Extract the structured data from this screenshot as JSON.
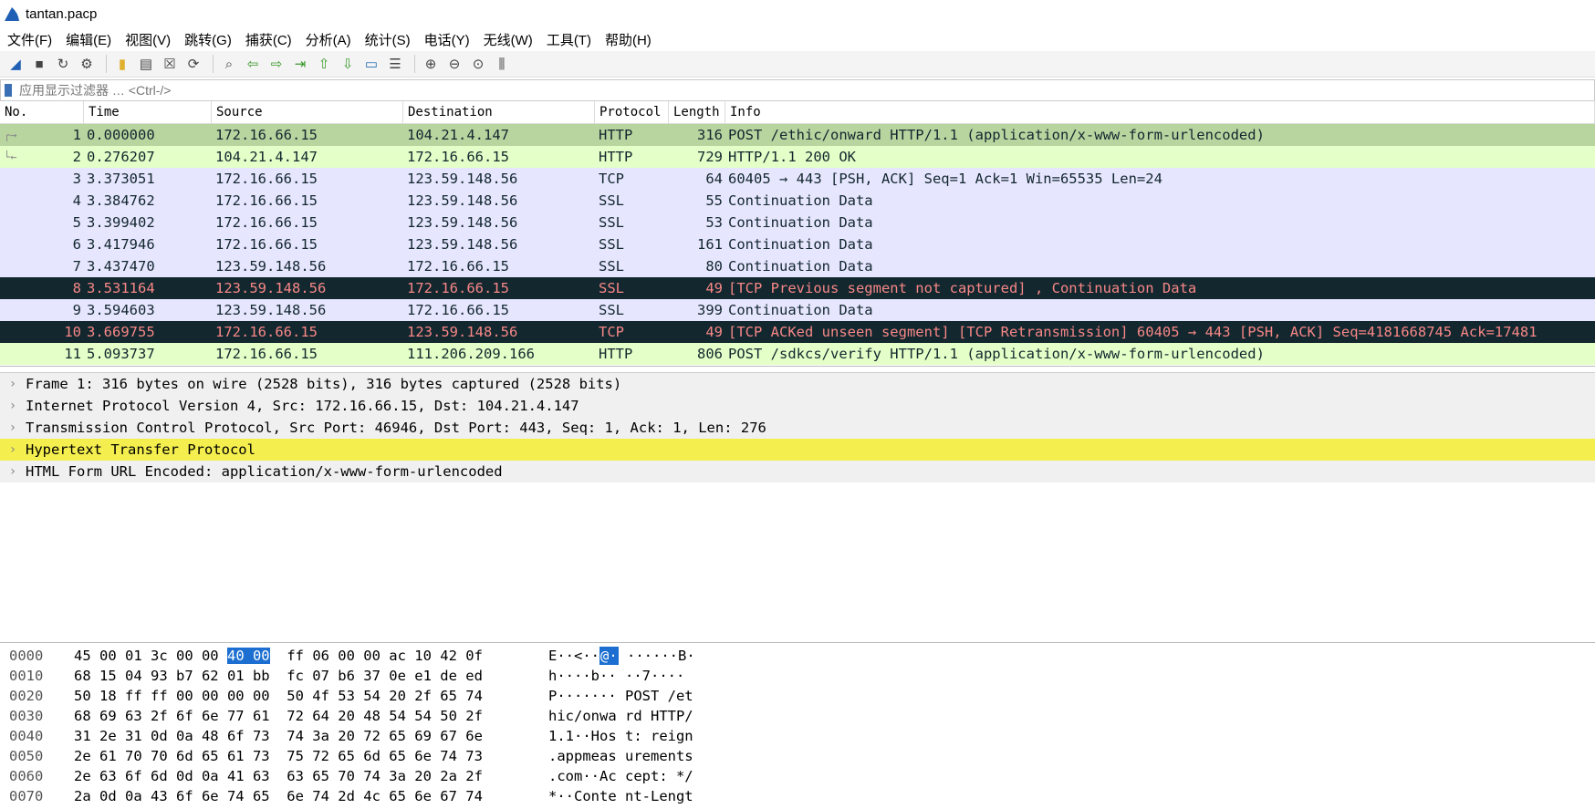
{
  "window": {
    "title": "tantan.pacp"
  },
  "menu": [
    "文件(F)",
    "编辑(E)",
    "视图(V)",
    "跳转(G)",
    "捕获(C)",
    "分析(A)",
    "统计(S)",
    "电话(Y)",
    "无线(W)",
    "工具(T)",
    "帮助(H)"
  ],
  "toolbar_icons": [
    "shark-fin-start-icon",
    "stop-icon",
    "restart-icon",
    "options-gear-icon",
    "open-folder-icon",
    "file-icon",
    "close-file-icon",
    "reload-icon",
    "find-icon",
    "back-arrow-icon",
    "forward-arrow-icon",
    "goto-packet-icon",
    "first-packet-icon",
    "last-packet-icon",
    "autoscroll-icon",
    "colorize-icon",
    "zoom-in-icon",
    "zoom-out-icon",
    "normal-size-icon",
    "resize-columns-icon"
  ],
  "filter": {
    "placeholder": "应用显示过滤器 … <Ctrl-/>"
  },
  "packet_list": {
    "columns": [
      "No.",
      "Time",
      "Source",
      "Destination",
      "Protocol",
      "Length",
      "Info"
    ],
    "rows": [
      {
        "no": "1",
        "time": "0.000000",
        "src": "172.16.66.15",
        "dst": "104.21.4.147",
        "proto": "HTTP",
        "len": "316",
        "info": "POST /ethic/onward HTTP/1.1  (application/x-www-form-urlencoded)",
        "bg": "#b8d5a0",
        "fg": "#12272e"
      },
      {
        "no": "2",
        "time": "0.276207",
        "src": "104.21.4.147",
        "dst": "172.16.66.15",
        "proto": "HTTP",
        "len": "729",
        "info": "HTTP/1.1 200 OK",
        "bg": "#e4ffc7",
        "fg": "#12272e"
      },
      {
        "no": "3",
        "time": "3.373051",
        "src": "172.16.66.15",
        "dst": "123.59.148.56",
        "proto": "TCP",
        "len": "64",
        "info": "60405 → 443 [PSH, ACK] Seq=1 Ack=1 Win=65535 Len=24",
        "bg": "#e7e6ff",
        "fg": "#12272e"
      },
      {
        "no": "4",
        "time": "3.384762",
        "src": "172.16.66.15",
        "dst": "123.59.148.56",
        "proto": "SSL",
        "len": "55",
        "info": "Continuation Data",
        "bg": "#e7e6ff",
        "fg": "#12272e"
      },
      {
        "no": "5",
        "time": "3.399402",
        "src": "172.16.66.15",
        "dst": "123.59.148.56",
        "proto": "SSL",
        "len": "53",
        "info": "Continuation Data",
        "bg": "#e7e6ff",
        "fg": "#12272e"
      },
      {
        "no": "6",
        "time": "3.417946",
        "src": "172.16.66.15",
        "dst": "123.59.148.56",
        "proto": "SSL",
        "len": "161",
        "info": "Continuation Data",
        "bg": "#e7e6ff",
        "fg": "#12272e"
      },
      {
        "no": "7",
        "time": "3.437470",
        "src": "123.59.148.56",
        "dst": "172.16.66.15",
        "proto": "SSL",
        "len": "80",
        "info": "Continuation Data",
        "bg": "#e7e6ff",
        "fg": "#12272e"
      },
      {
        "no": "8",
        "time": "3.531164",
        "src": "123.59.148.56",
        "dst": "172.16.66.15",
        "proto": "SSL",
        "len": "49",
        "info": "[TCP Previous segment not captured] , Continuation Data",
        "bg": "#12272e",
        "fg": "#f78787"
      },
      {
        "no": "9",
        "time": "3.594603",
        "src": "123.59.148.56",
        "dst": "172.16.66.15",
        "proto": "SSL",
        "len": "399",
        "info": "Continuation Data",
        "bg": "#e7e6ff",
        "fg": "#12272e"
      },
      {
        "no": "10",
        "time": "3.669755",
        "src": "172.16.66.15",
        "dst": "123.59.148.56",
        "proto": "TCP",
        "len": "49",
        "info": "[TCP ACKed unseen segment] [TCP Retransmission] 60405 → 443 [PSH, ACK] Seq=4181668745 Ack=17481",
        "bg": "#12272e",
        "fg": "#f78787"
      },
      {
        "no": "11",
        "time": "5.093737",
        "src": "172.16.66.15",
        "dst": "111.206.209.166",
        "proto": "HTTP",
        "len": "806",
        "info": "POST /sdkcs/verify HTTP/1.1  (application/x-www-form-urlencoded)",
        "bg": "#e4ffc7",
        "fg": "#12272e"
      }
    ]
  },
  "details": [
    {
      "text": "Frame 1: 316 bytes on wire (2528 bits), 316 bytes captured (2528 bits)",
      "bg": "#f0f0f0"
    },
    {
      "text": "Internet Protocol Version 4, Src: 172.16.66.15, Dst: 104.21.4.147",
      "bg": "#f0f0f0"
    },
    {
      "text": "Transmission Control Protocol, Src Port: 46946, Dst Port: 443, Seq: 1, Ack: 1, Len: 276",
      "bg": "#f0f0f0"
    },
    {
      "text": "Hypertext Transfer Protocol",
      "bg": "#f4ef4e"
    },
    {
      "text": "HTML Form URL Encoded: application/x-www-form-urlencoded",
      "bg": "#f0f0f0"
    }
  ],
  "hex": [
    {
      "off": "0000",
      "b1": "45 00 01 3c 00 00 ",
      "hlb": "40 00",
      "b2": "  ff 06 00 00 ac 10 42 0f",
      "a1": "E··<··",
      "hla": "@·",
      "a2": " ······B·"
    },
    {
      "off": "0010",
      "b1": "68 15 04 93 b7 62 01 bb  fc 07 b6 37 0e e1 de ed",
      "hlb": "",
      "b2": "",
      "a1": "h····b·· ··7····",
      "hla": "",
      "a2": ""
    },
    {
      "off": "0020",
      "b1": "50 18 ff ff 00 00 00 00  50 4f 53 54 20 2f 65 74",
      "hlb": "",
      "b2": "",
      "a1": "P······· POST /et",
      "hla": "",
      "a2": ""
    },
    {
      "off": "0030",
      "b1": "68 69 63 2f 6f 6e 77 61  72 64 20 48 54 54 50 2f",
      "hlb": "",
      "b2": "",
      "a1": "hic/onwa rd HTTP/",
      "hla": "",
      "a2": ""
    },
    {
      "off": "0040",
      "b1": "31 2e 31 0d 0a 48 6f 73  74 3a 20 72 65 69 67 6e",
      "hlb": "",
      "b2": "",
      "a1": "1.1··Hos t: reign",
      "hla": "",
      "a2": ""
    },
    {
      "off": "0050",
      "b1": "2e 61 70 70 6d 65 61 73  75 72 65 6d 65 6e 74 73",
      "hlb": "",
      "b2": "",
      "a1": ".appmeas urements",
      "hla": "",
      "a2": ""
    },
    {
      "off": "0060",
      "b1": "2e 63 6f 6d 0d 0a 41 63  63 65 70 74 3a 20 2a 2f",
      "hlb": "",
      "b2": "",
      "a1": ".com··Ac cept: */",
      "hla": "",
      "a2": ""
    },
    {
      "off": "0070",
      "b1": "2a 0d 0a 43 6f 6e 74 65  6e 74 2d 4c 65 6e 67 74",
      "hlb": "",
      "b2": "",
      "a1": "*··Conte nt-Lengt",
      "hla": "",
      "a2": ""
    }
  ]
}
